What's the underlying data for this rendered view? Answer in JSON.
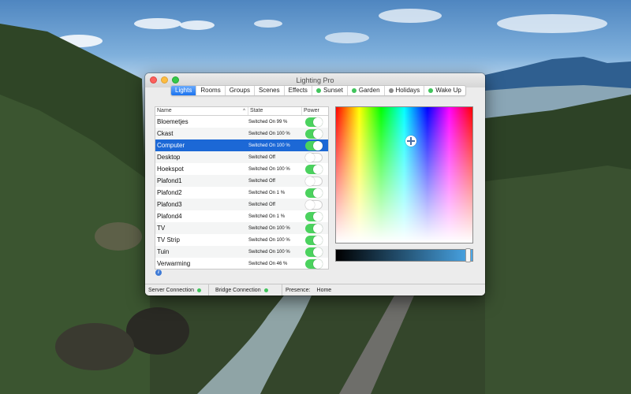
{
  "window": {
    "title": "Lighting Pro"
  },
  "tabs": [
    {
      "label": "Lights",
      "active": true,
      "has_dot": false
    },
    {
      "label": "Rooms",
      "active": false,
      "has_dot": false
    },
    {
      "label": "Groups",
      "active": false,
      "has_dot": false
    },
    {
      "label": "Scenes",
      "active": false,
      "has_dot": false
    },
    {
      "label": "Effects",
      "active": false,
      "has_dot": false
    },
    {
      "label": "Sunset",
      "active": false,
      "has_dot": true,
      "dot_color": "#41c45c"
    },
    {
      "label": "Garden",
      "active": false,
      "has_dot": true,
      "dot_color": "#41c45c"
    },
    {
      "label": "Holidays",
      "active": false,
      "has_dot": true,
      "dot_color": "#8a8a8a"
    },
    {
      "label": "Wake Up",
      "active": false,
      "has_dot": true,
      "dot_color": "#41c45c"
    }
  ],
  "table": {
    "columns": {
      "name": "Name",
      "state": "State",
      "power": "Power"
    },
    "sort_indicator": "chevron-up-icon",
    "rows": [
      {
        "name": "Bloemetjes",
        "state": "Switched On 99 %",
        "on": true
      },
      {
        "name": "Ckast",
        "state": "Switched On 100 %",
        "on": true
      },
      {
        "name": "Computer",
        "state": "Switched On 100 %",
        "on": true,
        "selected": true
      },
      {
        "name": "Desktop",
        "state": "Switched Off",
        "on": false
      },
      {
        "name": "Hoekspot",
        "state": "Switched On 100 %",
        "on": true
      },
      {
        "name": "Plafond1",
        "state": "Switched Off",
        "on": false
      },
      {
        "name": "Plafond2",
        "state": "Switched On 1 %",
        "on": true
      },
      {
        "name": "Plafond3",
        "state": "Switched Off",
        "on": false
      },
      {
        "name": "Plafond4",
        "state": "Switched On 1 %",
        "on": true
      },
      {
        "name": "TV",
        "state": "Switched On 100 %",
        "on": true
      },
      {
        "name": "TV Strip",
        "state": "Switched On 100 %",
        "on": true
      },
      {
        "name": "Tuin",
        "state": "Switched On 100 %",
        "on": true
      },
      {
        "name": "Verwarming",
        "state": "Switched On 46 %",
        "on": true
      }
    ]
  },
  "info_button": {
    "glyph": "i"
  },
  "color_picker": {
    "hue_fraction": 0.55,
    "saturation_fraction": 0.75
  },
  "brightness": {
    "value_fraction": 0.99,
    "end_color": "#4aa8ea"
  },
  "status": {
    "server": "Server Connection",
    "server_color": "#41c45c",
    "bridge": "Bridge Connection",
    "bridge_color": "#41c45c",
    "presence_label": "Presence:",
    "presence_value": "Home"
  },
  "colors": {
    "accent": "#1c68d6",
    "switch_on": "#4bd25e"
  }
}
